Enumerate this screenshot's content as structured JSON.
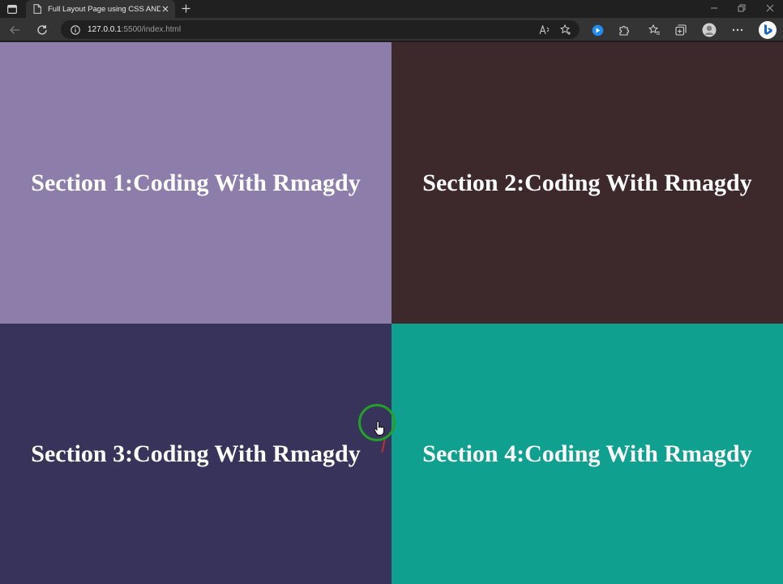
{
  "browser": {
    "tab": {
      "title": "Full Layout Page using CSS AND"
    },
    "address": {
      "host": "127.0.0.1",
      "rest": ":5500/index.html"
    }
  },
  "page": {
    "sections": [
      {
        "heading": "Section 1:Coding With Rmagdy",
        "color": "#8c7daa"
      },
      {
        "heading": "Section 2:Coding With Rmagdy",
        "color": "#3d282c"
      },
      {
        "heading": "Section 3:Coding With Rmagdy",
        "color": "#38335a"
      },
      {
        "heading": "Section 4:Coding With Rmagdy",
        "color": "#10a08f"
      }
    ]
  }
}
